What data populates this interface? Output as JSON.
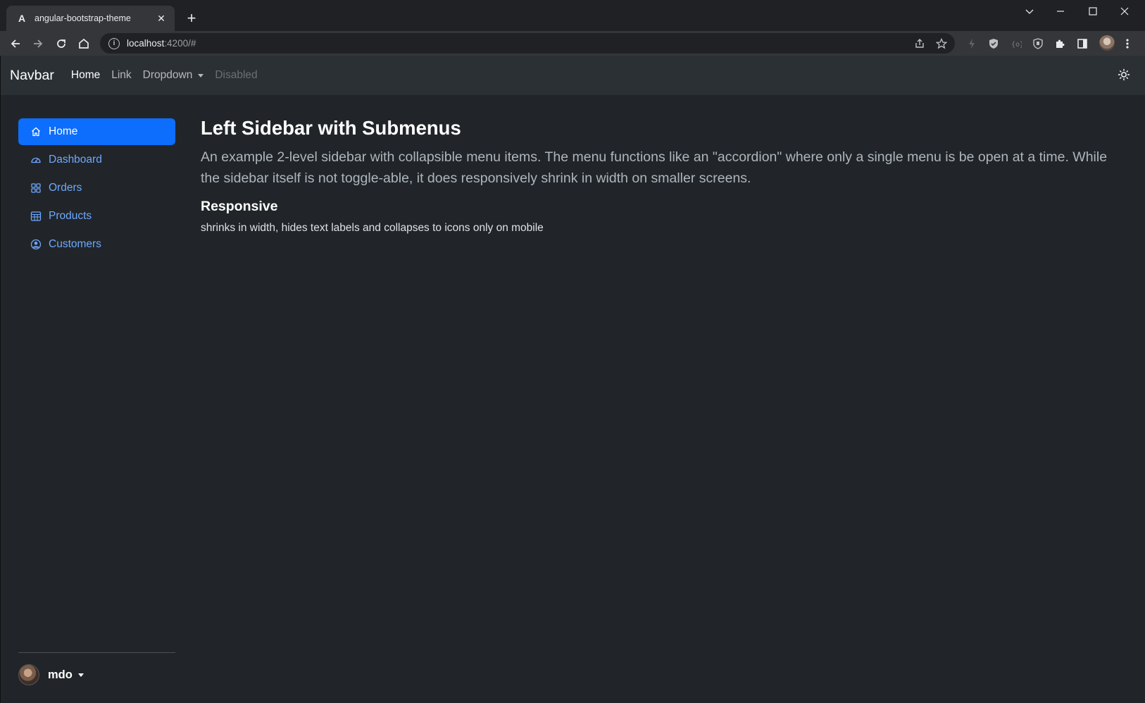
{
  "browser": {
    "tab_title": "angular-bootstrap-theme",
    "tab_favicon": "A",
    "url_host": "localhost",
    "url_rest": ":4200/#"
  },
  "navbar": {
    "brand": "Navbar",
    "links": [
      {
        "label": "Home",
        "state": "active"
      },
      {
        "label": "Link",
        "state": "normal"
      },
      {
        "label": "Dropdown",
        "state": "dropdown"
      },
      {
        "label": "Disabled",
        "state": "disabled"
      }
    ],
    "theme_toggle_icon": "sun-icon"
  },
  "sidebar": {
    "items": [
      {
        "label": "Home",
        "icon": "house-icon",
        "active": true
      },
      {
        "label": "Dashboard",
        "icon": "speedometer-icon",
        "active": false
      },
      {
        "label": "Orders",
        "icon": "grid-icon",
        "active": false
      },
      {
        "label": "Products",
        "icon": "table-icon",
        "active": false
      },
      {
        "label": "Customers",
        "icon": "person-circle-icon",
        "active": false
      }
    ],
    "user": {
      "name": "mdo"
    }
  },
  "main": {
    "title": "Left Sidebar with Submenus",
    "lead": "An example 2-level sidebar with collapsible menu items. The menu functions like an \"accordion\" where only a single menu is be open at a time. While the sidebar itself is not toggle-able, it does responsively shrink in width on smaller screens.",
    "subtitle": "Responsive",
    "description": "shrinks in width, hides text labels and collapses to icons only on mobile"
  },
  "colors": {
    "accent": "#0d6efd",
    "link": "#6ea8fe",
    "page_bg": "#212529",
    "navbar_bg": "#2b3035"
  }
}
